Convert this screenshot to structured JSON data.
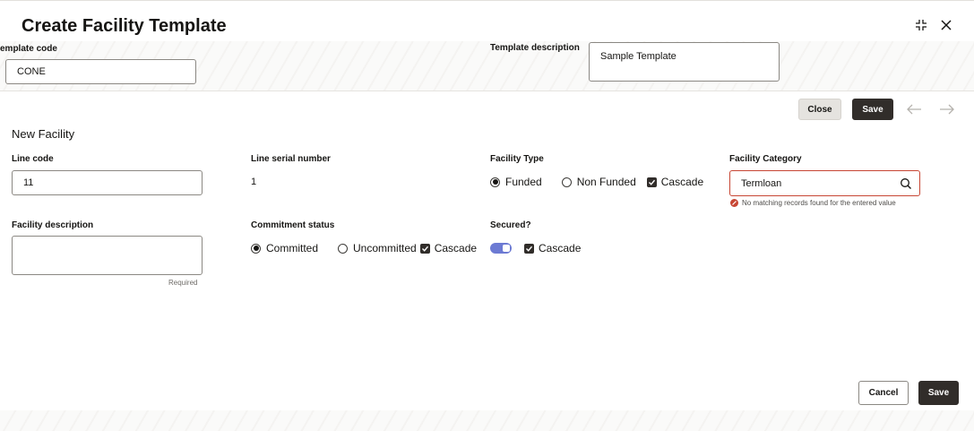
{
  "header": {
    "title": "Create Facility Template"
  },
  "template": {
    "code_label": "emplate code",
    "code_value": "CONE",
    "description_label": "Template description",
    "description_value": "Sample Template"
  },
  "toolbar": {
    "close_label": "Close",
    "save_label": "Save"
  },
  "section": {
    "title": "New Facility"
  },
  "fields": {
    "line_code_label": "Line code",
    "line_code_value": "11",
    "line_serial_label": "Line serial number",
    "line_serial_value": "1",
    "facility_type_label": "Facility Type",
    "facility_type_options": [
      "Funded",
      "Non Funded"
    ],
    "facility_type_selected": "Funded",
    "cascade_label": "Cascade",
    "facility_category_label": "Facility Category",
    "facility_category_value": "Termloan",
    "facility_category_error": "No matching records found for the entered value",
    "facility_description_label": "Facility description",
    "facility_description_hint": "Required",
    "commitment_label": "Commitment status",
    "commitment_options": [
      "Committed",
      "Uncommitted"
    ],
    "commitment_selected": "Committed",
    "secured_label": "Secured?",
    "secured_on": true
  },
  "footer": {
    "cancel_label": "Cancel",
    "save_label": "Save"
  },
  "colors": {
    "primary_dark": "#312d2a",
    "error": "#c74634",
    "toggle": "#6c7ad3"
  }
}
